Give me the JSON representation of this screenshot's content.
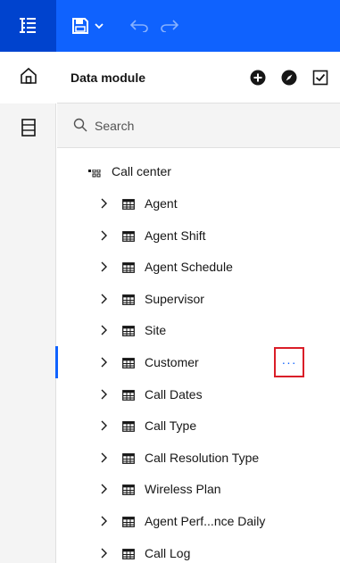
{
  "toolbar": {
    "menu_icon": "navigation-menu-icon",
    "save_icon": "save-icon",
    "dropdown_icon": "chevron-down-icon",
    "undo_icon": "undo-icon",
    "redo_icon": "redo-icon"
  },
  "rail": {
    "items": [
      {
        "icon": "home-icon",
        "active": true
      },
      {
        "icon": "data-table-icon",
        "active": false
      }
    ]
  },
  "panel": {
    "title": "Data module",
    "actions": [
      {
        "icon": "add-icon"
      },
      {
        "icon": "compass-icon"
      },
      {
        "icon": "checkbox-icon"
      }
    ]
  },
  "search": {
    "placeholder": "Search"
  },
  "tree": {
    "root_label": "Call center",
    "items": [
      {
        "label": "Agent"
      },
      {
        "label": "Agent Shift"
      },
      {
        "label": "Agent Schedule"
      },
      {
        "label": "Supervisor"
      },
      {
        "label": "Site"
      },
      {
        "label": "Customer",
        "selected": true,
        "overflow": "···"
      },
      {
        "label": "Call Dates"
      },
      {
        "label": "Call Type"
      },
      {
        "label": "Call Resolution Type"
      },
      {
        "label": "Wireless Plan"
      },
      {
        "label": "Agent Perf...nce Daily"
      },
      {
        "label": "Call Log"
      }
    ]
  },
  "colors": {
    "toolbar_bg": "#0f62fe",
    "toolbar_left": "#0043ce",
    "accent": "#0f62fe",
    "highlight_border": "#da1e28"
  }
}
